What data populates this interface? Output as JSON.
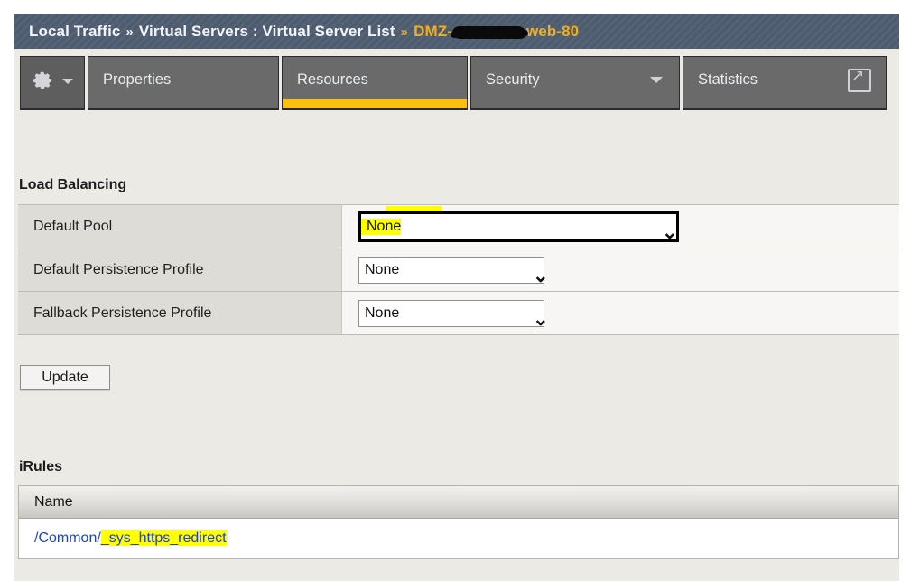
{
  "breadcrumb": {
    "module": "Local Traffic",
    "separator": "»",
    "section": "Virtual Servers : Virtual Server List",
    "current_prefix": "DMZ-",
    "current_suffix": "web-80",
    "redacted": true
  },
  "tabs": [
    {
      "id": "gear-menu",
      "label": "",
      "icon": "gear-icon",
      "has_caret": true,
      "active": false
    },
    {
      "id": "properties",
      "label": "Properties",
      "active": false
    },
    {
      "id": "resources",
      "label": "Resources",
      "active": true
    },
    {
      "id": "security",
      "label": "Security",
      "has_caret": true,
      "active": false
    },
    {
      "id": "statistics",
      "label": "Statistics",
      "icon": "external-link-icon",
      "active": false
    }
  ],
  "load_balancing": {
    "heading": "Load Balancing",
    "rows": [
      {
        "label": "Default Pool",
        "value": "None",
        "highlighted": true,
        "focused": true
      },
      {
        "label": "Default Persistence Profile",
        "value": "None",
        "highlighted": false,
        "focused": false
      },
      {
        "label": "Fallback Persistence Profile",
        "value": "None",
        "highlighted": false,
        "focused": false
      }
    ],
    "update_label": "Update"
  },
  "irules": {
    "heading": "iRules",
    "column_header": "Name",
    "rows": [
      {
        "path_prefix": "/Common/",
        "name": "_sys_https_redirect",
        "highlighted": true
      }
    ]
  },
  "colors": {
    "header_bar": "#4d5c6e",
    "breadcrumb_current": "#f5ae1b",
    "active_tab_underline": "#fcc012",
    "tab_background": "#6a6a6a",
    "highlight": "#ffff00",
    "link": "#1b3fd8",
    "page_background": "#eceae5"
  }
}
